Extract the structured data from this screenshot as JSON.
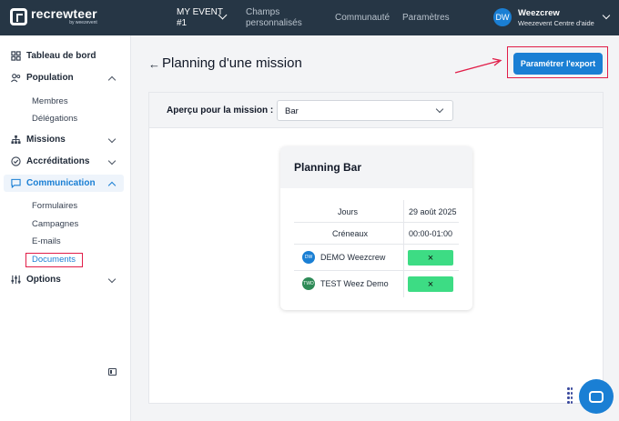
{
  "topbar": {
    "brand": "recrewteer",
    "brand_sub": "by weezevent",
    "event_line1": "MY EVENT",
    "event_line2": "#1",
    "nav": [
      "Champs",
      "personnalisés",
      "Communauté",
      "Paramètres"
    ],
    "user_initials": "DW",
    "user_name": "Weezcrew",
    "user_org": "Weezevent Centre d'aide"
  },
  "sidebar": {
    "dashboard": "Tableau de bord",
    "population": "Population",
    "membres": "Membres",
    "delegations": "Délégations",
    "missions": "Missions",
    "accreditations": "Accréditations",
    "communication": "Communication",
    "formulaires": "Formulaires",
    "campagnes": "Campagnes",
    "emails": "E-mails",
    "documents": "Documents",
    "options": "Options"
  },
  "main": {
    "title": "Planning d'une mission",
    "export_button": "Paramétrer l'export",
    "apercu_label": "Aperçu pour la mission :",
    "selected_mission": "Bar"
  },
  "card": {
    "title": "Planning Bar",
    "jours_label": "Jours",
    "jours_value": "29 août 2025",
    "creneaux_label": "Créneaux",
    "creneaux_value": "00:00-01:00",
    "members": [
      {
        "initials": "DW",
        "name": "DEMO Weezcrew",
        "color": "#1a7fd4",
        "mark": "×"
      },
      {
        "initials": "TWD",
        "name": "TEST Weez Demo",
        "color": "#2e8b57",
        "mark": "×"
      }
    ]
  },
  "colors": {
    "topbar": "#263645",
    "accent": "#1a7fd4",
    "highlight": "#e11d48",
    "cell_green": "#3ddc84"
  }
}
